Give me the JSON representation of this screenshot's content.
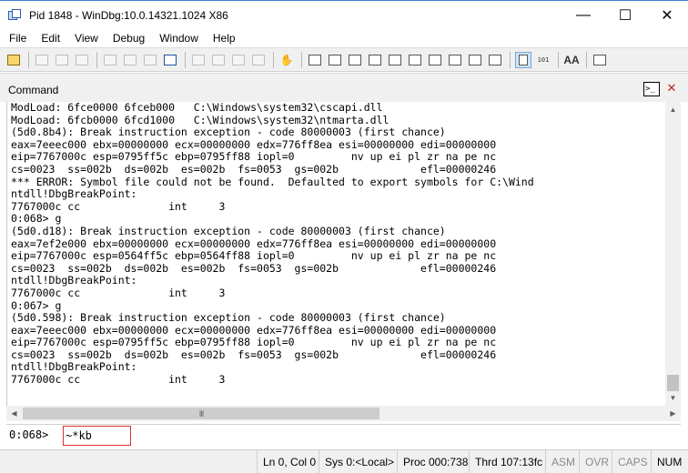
{
  "window": {
    "title": "Pid 1848 - WinDbg:10.0.14321.1024 X86",
    "minimize": "—",
    "maximize": "☐",
    "close": "✕"
  },
  "menu": [
    "File",
    "Edit",
    "View",
    "Debug",
    "Window",
    "Help"
  ],
  "toolbar": {
    "icons": [
      "open-icon",
      "cut-icon",
      "copy-icon",
      "paste-icon",
      "go-icon",
      "restart-icon",
      "stop-icon",
      "break-icon",
      "step-into-icon",
      "step-over-icon",
      "step-out-icon",
      "run-to-cursor-icon",
      "hand-icon",
      "command-window-icon",
      "watch-window-icon",
      "locals-window-icon",
      "registers-window-icon",
      "memory-window-icon",
      "call-stack-window-icon",
      "disassembly-window-icon",
      "scratch-pad-icon",
      "processes-threads-icon",
      "command-browser-icon",
      "source-mode-icon",
      "hex-mode-icon",
      "font-icon",
      "options-icon"
    ],
    "font_label": "AA",
    "hex_label": "101"
  },
  "command_window": {
    "title": "Command",
    "tab_icon_text": ">_",
    "close_label": "✕"
  },
  "output_lines": [
    "ModLoad: 6fce0000 6fceb000   C:\\Windows\\system32\\cscapi.dll",
    "ModLoad: 6fcb0000 6fcd1000   C:\\Windows\\system32\\ntmarta.dll",
    "(5d0.8b4): Break instruction exception - code 80000003 (first chance)",
    "eax=7eeec000 ebx=00000000 ecx=00000000 edx=776ff8ea esi=00000000 edi=00000000",
    "eip=7767000c esp=0795ff5c ebp=0795ff88 iopl=0         nv up ei pl zr na pe nc",
    "cs=0023  ss=002b  ds=002b  es=002b  fs=0053  gs=002b             efl=00000246",
    "*** ERROR: Symbol file could not be found.  Defaulted to export symbols for C:\\Wind",
    "ntdll!DbgBreakPoint:",
    "7767000c cc              int     3",
    "0:068> g",
    "(5d0.d18): Break instruction exception - code 80000003 (first chance)",
    "eax=7ef2e000 ebx=00000000 ecx=00000000 edx=776ff8ea esi=00000000 edi=00000000",
    "eip=7767000c esp=0564ff5c ebp=0564ff88 iopl=0         nv up ei pl zr na pe nc",
    "cs=0023  ss=002b  ds=002b  es=002b  fs=0053  gs=002b             efl=00000246",
    "ntdll!DbgBreakPoint:",
    "7767000c cc              int     3",
    "0:067> g",
    "(5d0.598): Break instruction exception - code 80000003 (first chance)",
    "eax=7eeec000 ebx=00000000 ecx=00000000 edx=776ff8ea esi=00000000 edi=00000000",
    "eip=7767000c esp=0795ff5c ebp=0795ff88 iopl=0         nv up ei pl zr na pe nc",
    "cs=0023  ss=002b  ds=002b  es=002b  fs=0053  gs=002b             efl=00000246",
    "ntdll!DbgBreakPoint:",
    "7767000c cc              int     3"
  ],
  "scrollbars": {
    "up": "▲",
    "down": "▼",
    "left": "◀",
    "right": "▶",
    "grip": "III"
  },
  "command_input": {
    "prompt": "0:068>",
    "value": "~*kb"
  },
  "status": {
    "position": "Ln 0, Col 0",
    "sys": "Sys 0:<Local>",
    "proc": "Proc 000:738",
    "thrd": "Thrd 107:13fc",
    "asm": "ASM",
    "ovr": "OVR",
    "caps": "CAPS",
    "num": "NUM"
  }
}
